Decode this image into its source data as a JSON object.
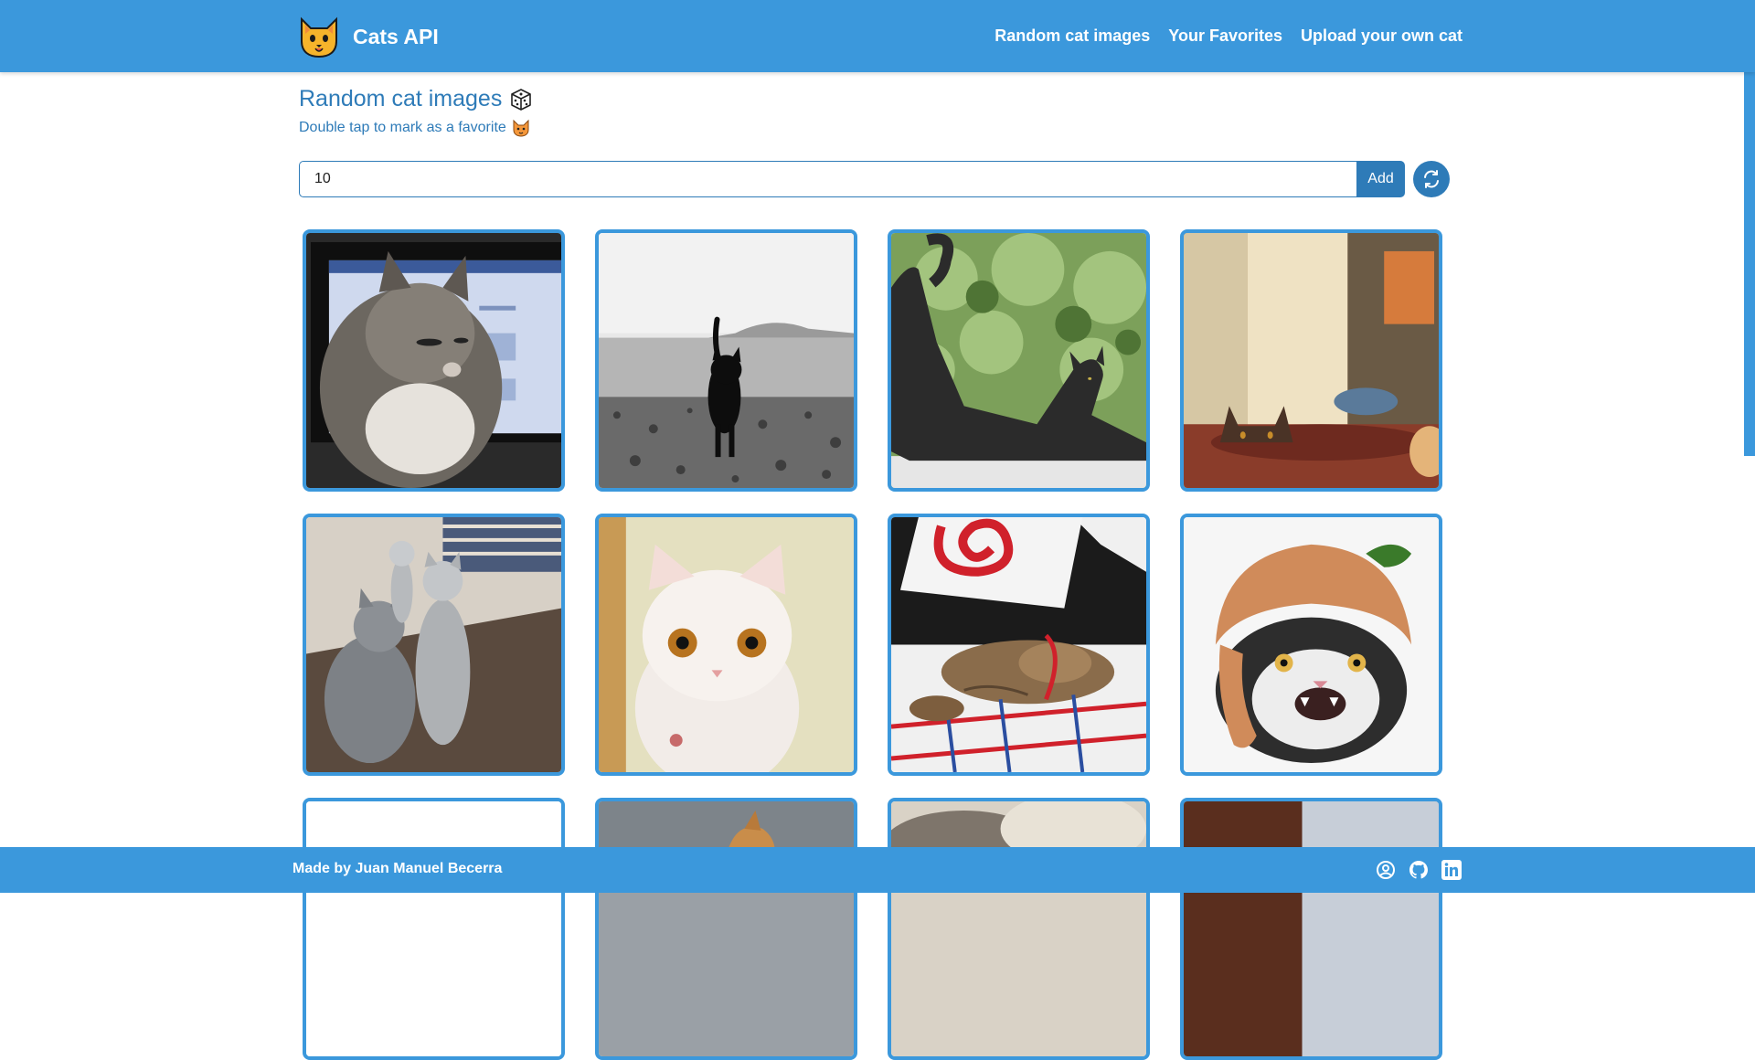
{
  "header": {
    "brand": "Cats API",
    "nav": [
      "Random cat images",
      "Your Favorites",
      "Upload your own cat"
    ]
  },
  "main": {
    "title": "Random cat images",
    "subtitle": "Double tap to mark as a favorite",
    "count_value": "10",
    "add_label": "Add"
  },
  "icons": {
    "logo": "cat-face-icon",
    "title_icon": "dice-icon",
    "subtitle_icon": "cat-face-icon",
    "refresh": "refresh-icon",
    "footer": [
      "user-circle-icon",
      "github-icon",
      "linkedin-icon"
    ]
  },
  "footer": {
    "credit": "Made by Juan Manuel Becerra"
  },
  "colors": {
    "primary": "#3b98dc",
    "accent": "#2e7bb8"
  }
}
